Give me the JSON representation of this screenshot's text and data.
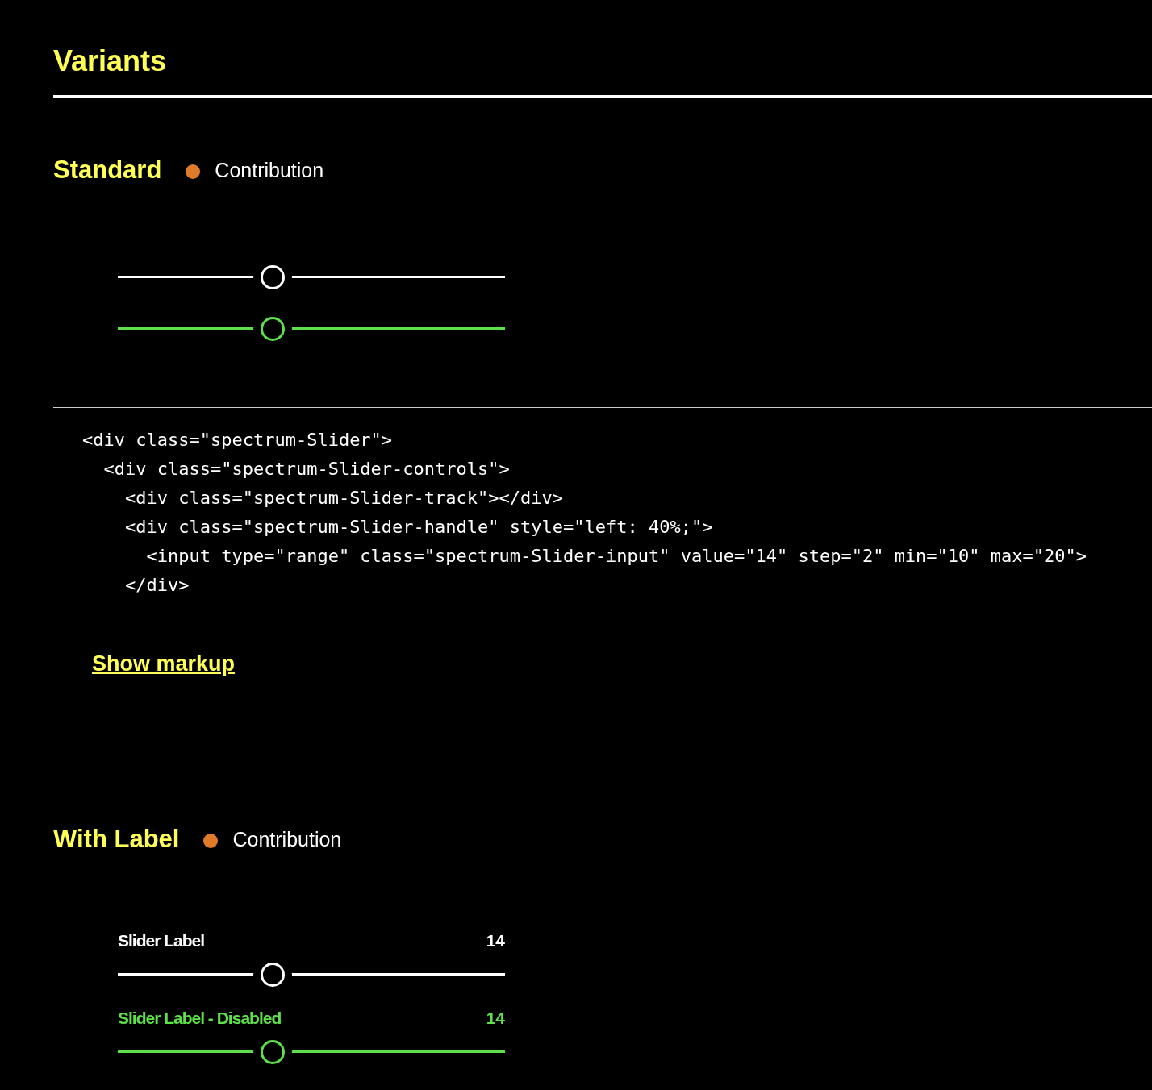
{
  "page_title": "Variants",
  "sections": [
    {
      "title": "Standard",
      "status": {
        "label": "Contribution",
        "color": "#e07b2a"
      },
      "sliders": [
        {
          "level": 0.4,
          "disabled": false
        },
        {
          "level": 0.4,
          "disabled": true
        }
      ],
      "code": [
        "<div class=\"spectrum-Slider\">",
        "  <div class=\"spectrum-Slider-controls\">",
        "    <div class=\"spectrum-Slider-track\"></div>",
        "    <div class=\"spectrum-Slider-handle\" style=\"left: 40%;\">",
        "      <input type=\"range\" class=\"spectrum-Slider-input\" value=\"14\" step=\"2\" min=\"10\" max=\"20\">",
        "    </div>"
      ],
      "show_markup": "Show markup"
    },
    {
      "title": "With Label",
      "status": {
        "label": "Contribution",
        "color": "#e07b2a"
      },
      "sliders": [
        {
          "label": "Slider Label",
          "value": "14",
          "level": 0.4,
          "disabled": false
        },
        {
          "label": "Slider Label - Disabled",
          "value": "14",
          "level": 0.4,
          "disabled": true
        }
      ]
    }
  ]
}
